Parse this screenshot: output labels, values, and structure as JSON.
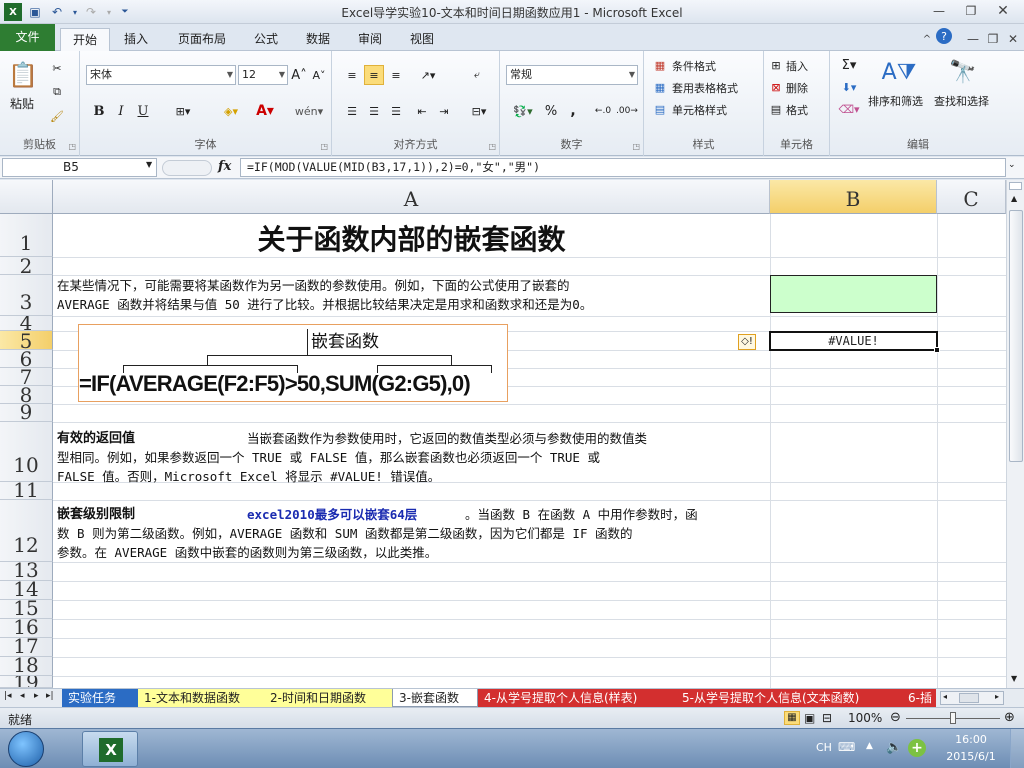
{
  "window": {
    "title": "Excel导学实验10-文本和时间日期函数应用1  -  Microsoft Excel"
  },
  "ribbon": {
    "tabs": [
      "文件",
      "开始",
      "插入",
      "页面布局",
      "公式",
      "数据",
      "审阅",
      "视图"
    ],
    "clipboard": {
      "paste": "粘贴",
      "label": "剪贴板"
    },
    "font": {
      "name": "宋体",
      "size": "12",
      "label": "字体",
      "bold": "B",
      "italic": "I",
      "underline": "U"
    },
    "alignment": {
      "label": "对齐方式"
    },
    "number": {
      "format": "常规",
      "percent": "%",
      "comma": ",",
      "label": "数字"
    },
    "styles": {
      "conditional": "条件格式",
      "table": "套用表格格式",
      "cell": "单元格样式",
      "label": "样式"
    },
    "cells": {
      "insert": "插入",
      "delete": "删除",
      "format": "格式",
      "label": "单元格"
    },
    "editing": {
      "sort": "排序和筛选",
      "find": "查找和选择",
      "label": "编辑"
    }
  },
  "formula_bar": {
    "name_box": "B5",
    "fx": "fx",
    "formula": "=IF(MOD(VALUE(MID(B3,17,1)),2)=0,\"女\",\"男\")"
  },
  "grid": {
    "columns": [
      "A",
      "B",
      "C"
    ],
    "rows": [
      "1",
      "2",
      "3",
      "4",
      "5",
      "6",
      "7",
      "8",
      "9",
      "10",
      "11",
      "12",
      "13",
      "14",
      "15",
      "16",
      "17",
      "18",
      "19"
    ],
    "title": "关于函数内部的嵌套函数",
    "row3": [
      "在某些情况下，可能需要将某函数作为另一函数的参数使用。例如，下面的公式使用了嵌套的",
      "AVERAGE 函数并将结果与值 50 进行了比较。并根据比较结果决定是用求和函数求和还是为0。"
    ],
    "diagram": {
      "caption": "嵌套函数",
      "formula": "=IF(AVERAGE(F2:F5)>50,SUM(G2:G5),0)"
    },
    "b5_value": "#VALUE!",
    "row10": {
      "heading": "有效的返回值",
      "lines": [
        "当嵌套函数作为参数使用时，它返回的数值类型必须与参数使用的数值类",
        "型相同。例如，如果参数返回一个 TRUE 或 FALSE 值，那么嵌套函数也必须返回一个 TRUE 或",
        "FALSE 值。否则，Microsoft Excel 将显示 #VALUE! 错误值。"
      ]
    },
    "row12": {
      "heading": "嵌套级别限制",
      "highlight": "excel2010最多可以嵌套64层",
      "lines": [
        "。当函数 B 在函数 A 中用作参数时，函",
        "数 B 则为第二级函数。例如，AVERAGE 函数和 SUM 函数都是第二级函数，因为它们都是 IF 函数的",
        "参数。在 AVERAGE 函数中嵌套的函数则为第三级函数，以此类推。"
      ]
    }
  },
  "sheets": [
    "实验任务",
    "1-文本和数据函数",
    "2-时间和日期函数",
    "3-嵌套函数",
    "4-从学号提取个人信息(样表)",
    "5-从学号提取个人信息(文本函数)",
    "6-插"
  ],
  "status": {
    "ready": "就绪",
    "zoom": "100%"
  },
  "taskbar": {
    "lang": "CH",
    "time": "16:00",
    "date": "2015/6/1"
  },
  "colors": {
    "accent_green": "#2e7d32",
    "b3_fill": "#ccffcc",
    "sheet_tab_highlight": "#ffff99"
  }
}
